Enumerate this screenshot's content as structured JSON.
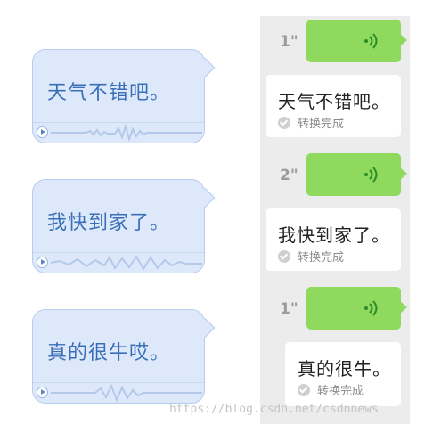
{
  "left_messages": [
    {
      "text": "天气不错吧。"
    },
    {
      "text": "我快到家了。"
    },
    {
      "text": "真的很牛哎。"
    }
  ],
  "right_messages": [
    {
      "duration": "1\"",
      "transcript": "天气不错吧。",
      "status": "转换完成"
    },
    {
      "duration": "2\"",
      "transcript": "我快到家了。",
      "status": "转换完成"
    },
    {
      "duration": "1\"",
      "transcript": "真的很牛。",
      "status": "转换完成"
    }
  ],
  "watermark": "https://blog.csdn.net/csdnnews",
  "colors": {
    "left_bubble_bg": "#dde9fa",
    "left_text": "#3a6fb8",
    "green_bubble": "#8fd95f",
    "panel_bg": "#ececec"
  },
  "icons": [
    "play-icon",
    "voice-waveform",
    "sound-wave-icon",
    "check-circle-icon"
  ]
}
